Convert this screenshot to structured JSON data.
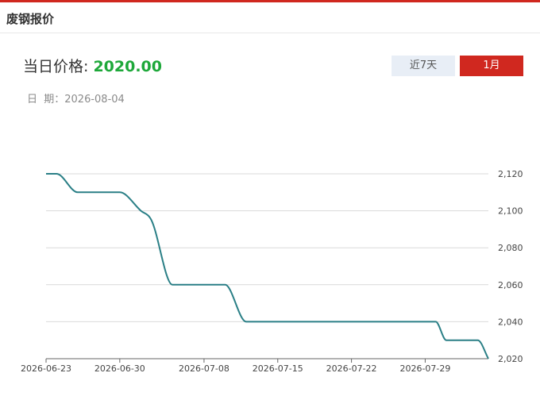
{
  "header": {
    "title": "废钢报价"
  },
  "price": {
    "label": "当日价格: ",
    "value": "2020.00"
  },
  "date": {
    "label": "日  期：",
    "value": "2026-08-04"
  },
  "range_buttons": {
    "week_label": "近7天",
    "month_label": "1月",
    "active": "1月"
  },
  "colors": {
    "accent": "#d0281f",
    "price_green": "#1ea83a",
    "line": "#2a7f86",
    "grid": "#d9d9d9"
  },
  "chart_data": {
    "type": "line",
    "title": "",
    "xlabel": "",
    "ylabel": "",
    "x_ticks": [
      "2026-06-23",
      "2026-06-30",
      "2026-07-08",
      "2026-07-15",
      "2026-07-22",
      "2026-07-29"
    ],
    "y_ticks": [
      "2,020",
      "2,040",
      "2,060",
      "2,080",
      "2,100",
      "2,120"
    ],
    "ylim": [
      2020,
      2120
    ],
    "y_axis_position": "right",
    "grid": true,
    "series": [
      {
        "values": [
          {
            "x": "2026-06-23",
            "y": 2120
          },
          {
            "x": "2026-06-24",
            "y": 2120
          },
          {
            "x": "2026-06-26",
            "y": 2110
          },
          {
            "x": "2026-06-29",
            "y": 2110
          },
          {
            "x": "2026-06-30",
            "y": 2110
          },
          {
            "x": "2026-07-02",
            "y": 2100
          },
          {
            "x": "2026-07-03",
            "y": 2095
          },
          {
            "x": "2026-07-05",
            "y": 2060
          },
          {
            "x": "2026-07-06",
            "y": 2060
          },
          {
            "x": "2026-07-09",
            "y": 2060
          },
          {
            "x": "2026-07-10",
            "y": 2060
          },
          {
            "x": "2026-07-12",
            "y": 2040
          },
          {
            "x": "2026-07-13",
            "y": 2040
          },
          {
            "x": "2026-07-29",
            "y": 2040
          },
          {
            "x": "2026-07-30",
            "y": 2040
          },
          {
            "x": "2026-07-31",
            "y": 2030
          },
          {
            "x": "2026-08-03",
            "y": 2030
          },
          {
            "x": "2026-08-04",
            "y": 2020
          }
        ]
      }
    ]
  }
}
